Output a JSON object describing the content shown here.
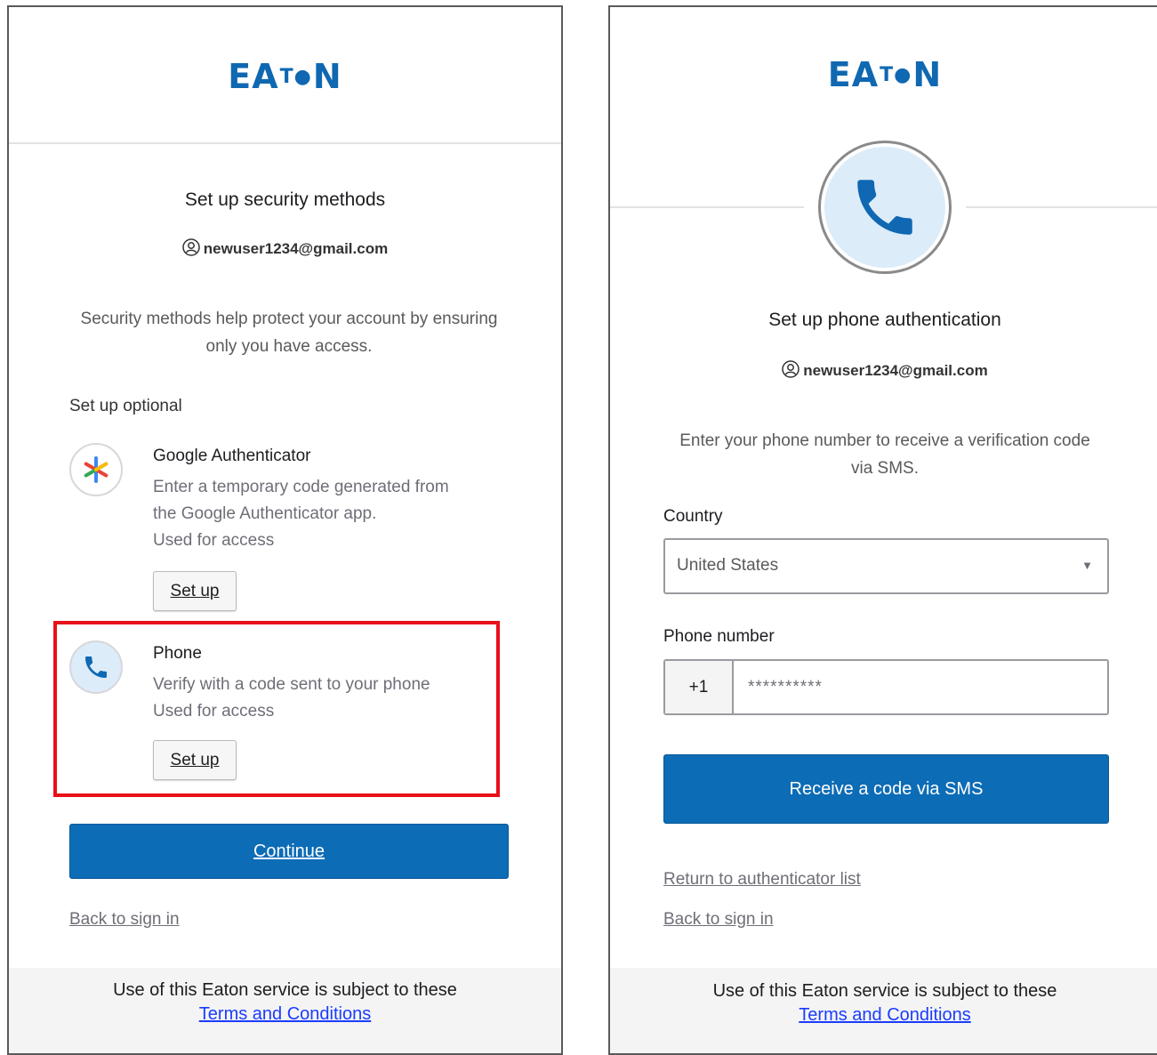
{
  "left": {
    "brand": {
      "logo_text_a": "EA",
      "logo_text_b": "N"
    },
    "title": "Set up security methods",
    "user_email": "newuser1234@gmail.com",
    "description": "Security methods help protect your account by ensuring only you have access.",
    "section_label": "Set up optional",
    "methods": [
      {
        "title": "Google Authenticator",
        "description_line1": "Enter a temporary code generated from",
        "description_line2": "the Google Authenticator app.",
        "usage": "Used for access",
        "button_label": "Set up",
        "icon": "google-authenticator-icon"
      },
      {
        "title": "Phone",
        "description_line1": "Verify with a code sent to your phone",
        "usage": "Used for access",
        "button_label": "Set up",
        "icon": "phone-icon"
      }
    ],
    "continue_label": "Continue",
    "back_link": "Back to sign in",
    "footer_text": "Use of this Eaton service is subject to these",
    "footer_link": "Terms and Conditions"
  },
  "right": {
    "brand": {
      "logo_text_a": "EA",
      "logo_text_b": "N"
    },
    "title": "Set up phone authentication",
    "user_email": "newuser1234@gmail.com",
    "description": "Enter your phone number to receive a verification code via SMS.",
    "country_label": "Country",
    "country_value": "United States",
    "phone_label": "Phone number",
    "country_code": "+1",
    "phone_value": "**********",
    "sms_button_label": "Receive a code via SMS",
    "return_link": "Return to authenticator list",
    "back_link": "Back to sign in",
    "footer_text": "Use of this Eaton service is subject to these",
    "footer_link": "Terms and Conditions"
  },
  "colors": {
    "brand_blue": "#0f68b1",
    "primary_button": "#0d6cb6",
    "highlight_red": "#e8101a",
    "link_blue": "#1a3cff",
    "phone_icon_bg": "#dcecf9"
  }
}
